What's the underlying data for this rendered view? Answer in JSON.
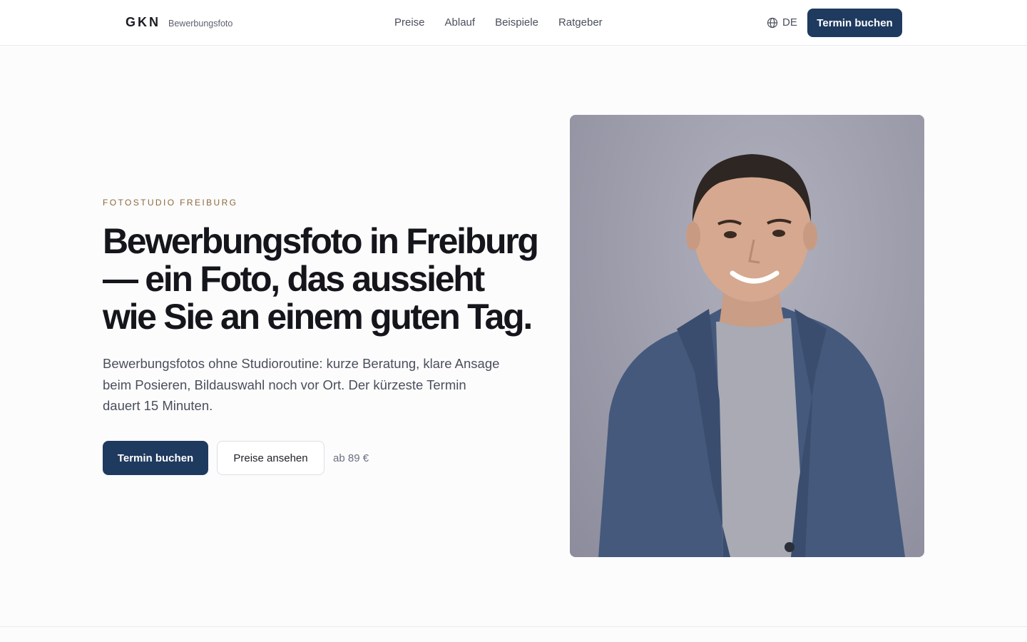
{
  "brand": {
    "mark": "GKN",
    "subtitle": "Bewerbungsfoto"
  },
  "nav": {
    "items": [
      "Preise",
      "Ablauf",
      "Beispiele",
      "Ratgeber"
    ]
  },
  "language": {
    "label": "DE",
    "icon": "globe-icon"
  },
  "header_cta": "Termin buchen",
  "hero": {
    "eyebrow": "FOTOSTUDIO FREIBURG",
    "headline": "Bewerbungsfoto in Freiburg — ein Foto, das aussieht wie Sie an einem guten Tag.",
    "lead": "Bewerbungsfotos ohne Studioroutine: kurze Beratung, klare Ansage beim Posieren, Bildauswahl noch vor Ort. Der kürzeste Termin dauert 15 Minuten.",
    "primary_cta": "Termin buchen",
    "secondary_cta": "Preise ansehen",
    "price_note": "ab 89 €"
  },
  "colors": {
    "accent": "#1f3a5f",
    "eyebrow": "#8a6a3c",
    "text": "#14161b",
    "muted": "#4a4f5c"
  }
}
